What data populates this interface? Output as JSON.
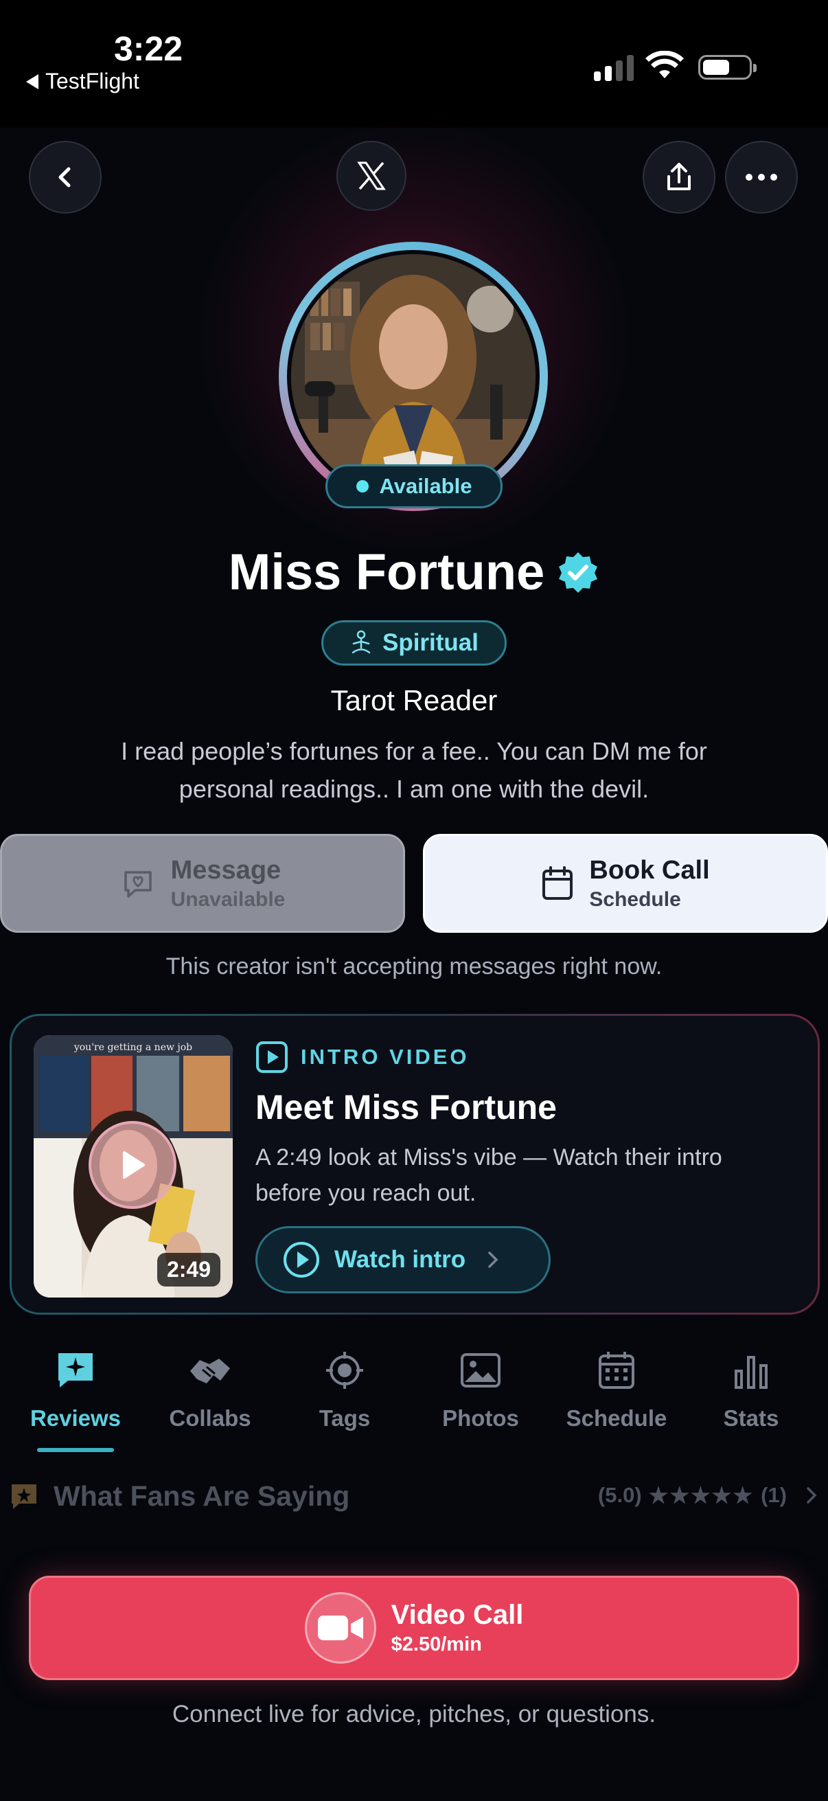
{
  "status_bar": {
    "time": "3:22",
    "back_app": "TestFlight"
  },
  "header": {
    "x_logo": "X"
  },
  "profile": {
    "availability": "Available",
    "name": "Miss Fortune",
    "category": "Spiritual",
    "role": "Tarot Reader",
    "bio_line1": "I read people’s fortunes for a fee.. You can DM me for",
    "bio_line2": "personal readings.. I am one with the devil."
  },
  "actions": {
    "message": {
      "title": "Message",
      "subtitle": "Unavailable"
    },
    "book": {
      "title": "Book Call",
      "subtitle": "Schedule"
    },
    "notice": "This creator isn't accepting messages right now."
  },
  "intro": {
    "label": "INTRO VIDEO",
    "title": "Meet Miss Fortune",
    "desc_line1": "A 2:49 look at Miss's vibe — Watch their intro",
    "desc_line2": "before you reach out.",
    "duration": "2:49",
    "thumb_caption": "you're getting a new job",
    "watch_label": "Watch intro"
  },
  "tabs": [
    {
      "label": "Reviews",
      "icon": "sparkle-chat-icon",
      "active": true
    },
    {
      "label": "Collabs",
      "icon": "handshake-icon",
      "active": false
    },
    {
      "label": "Tags",
      "icon": "target-icon",
      "active": false
    },
    {
      "label": "Photos",
      "icon": "photos-icon",
      "active": false
    },
    {
      "label": "Schedule",
      "icon": "calendar-icon",
      "active": false
    },
    {
      "label": "Stats",
      "icon": "bar-chart-icon",
      "active": false
    }
  ],
  "reviews": {
    "title": "What Fans Are Saying",
    "rating": "(5.0)",
    "stars": "★★★★★",
    "count": "(1)"
  },
  "video_call": {
    "title": "Video Call",
    "price": "$2.50/min",
    "caption": "Connect live for advice, pitches, or questions."
  },
  "colors": {
    "accent": "#5fd0e0",
    "call": "#e8405a",
    "background": "#05070d"
  }
}
